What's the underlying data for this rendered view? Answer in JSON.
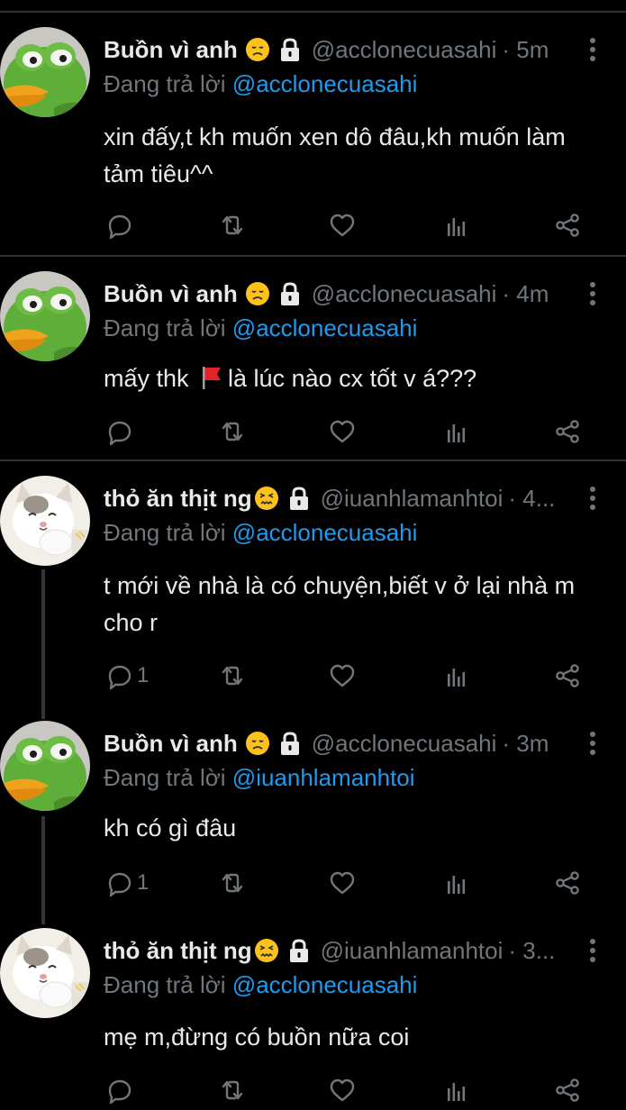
{
  "colors": {
    "background": "#000000",
    "text": "#e7e9ea",
    "muted": "#71767b",
    "accent": "#1d9bf0",
    "divider": "#2f3336"
  },
  "reply_prefix": "Đang trả lời",
  "tweets": [
    {
      "name": "Buồn vì anh",
      "handle": "@acclonecuasahi",
      "time": "· 5m",
      "reply_to": "@acclonecuasahi",
      "text": "xin đấy,t kh muốn xen dô đâu,kh muốn làm tảm tiêu^^",
      "reply_count": "",
      "avatar": "frog-avatar",
      "emoji": "disappointed-face-emoji"
    },
    {
      "name": "Buồn vì anh",
      "handle": "@acclonecuasahi",
      "time": "· 4m",
      "reply_to": "@acclonecuasahi",
      "text_before": "mấy thk ",
      "text_after": "là lúc nào cx tốt v á???",
      "reply_count": "",
      "avatar": "frog-avatar",
      "emoji": "disappointed-face-emoji"
    },
    {
      "name": "thỏ ăn thịt ng",
      "handle": "@iuanhlamanhtoi",
      "time": "· 4...",
      "reply_to": "@acclonecuasahi",
      "text": "t mới về nhà là có chuyện,biết v ở lại nhà m cho r",
      "reply_count": "1",
      "avatar": "cat-avatar",
      "emoji": "confounded-face-emoji"
    },
    {
      "name": "Buồn vì anh",
      "handle": "@acclonecuasahi",
      "time": "· 3m",
      "reply_to": "@iuanhlamanhtoi",
      "text": "kh có gì đâu",
      "reply_count": "1",
      "avatar": "frog-avatar",
      "emoji": "disappointed-face-emoji"
    },
    {
      "name": "thỏ ăn thịt ng",
      "handle": "@iuanhlamanhtoi",
      "time": "· 3...",
      "reply_to": "@acclonecuasahi",
      "text": "mẹ m,đừng có buồn nữa coi",
      "reply_count": "",
      "avatar": "cat-avatar",
      "emoji": "confounded-face-emoji"
    }
  ]
}
